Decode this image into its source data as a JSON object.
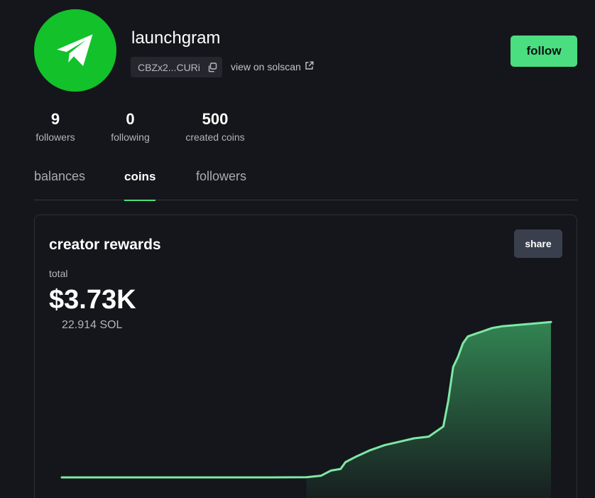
{
  "profile": {
    "username": "launchgram",
    "address_short": "CBZx2...CURi",
    "solscan_label": "view on solscan",
    "follow_label": "follow",
    "avatar_icon": "telegram-paper-plane-icon"
  },
  "stats": {
    "followers": {
      "value": "9",
      "label": "followers"
    },
    "following": {
      "value": "0",
      "label": "following"
    },
    "created": {
      "value": "500",
      "label": "created coins"
    }
  },
  "tabs": {
    "items": [
      {
        "label": "balances",
        "active": false
      },
      {
        "label": "coins",
        "active": true
      },
      {
        "label": "followers",
        "active": false
      }
    ]
  },
  "rewards": {
    "title": "creator rewards",
    "share_label": "share",
    "total_label": "total",
    "total_usd": "$3.73K",
    "total_sol": "22.914 SOL"
  },
  "colors": {
    "accent": "#4ade80",
    "avatar_bg": "#13c12b",
    "background": "#15161b"
  },
  "chart_data": {
    "type": "area",
    "title": "",
    "xlabel": "",
    "ylabel": "",
    "grid": false,
    "x": [
      0,
      10,
      20,
      30,
      40,
      50,
      53,
      55,
      57,
      58,
      60,
      63,
      66,
      69,
      72,
      75,
      78,
      79,
      80,
      81,
      82,
      83,
      84,
      85,
      86,
      87,
      88,
      89,
      90,
      92,
      94,
      96,
      98,
      100
    ],
    "values": [
      0,
      0,
      0,
      0,
      0,
      0.1,
      1,
      4,
      5,
      9,
      12,
      16,
      19,
      21,
      23,
      24,
      30,
      45,
      65,
      71,
      79,
      83,
      84,
      85,
      86,
      87,
      88,
      88.5,
      89,
      89.5,
      90,
      90.5,
      91,
      91.5
    ],
    "ylim": [
      0,
      100
    ]
  }
}
